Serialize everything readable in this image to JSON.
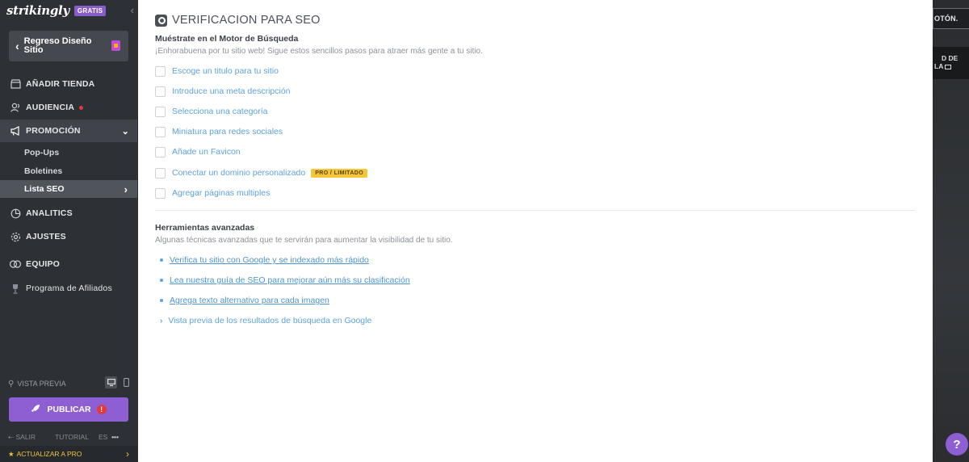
{
  "brand": {
    "logo": "strikingly",
    "plan_badge": "GRATIS",
    "collapse_icon": "chevron-left-icon"
  },
  "back_button": {
    "label": "Regreso Diseño Sitio",
    "icon": "page-icon"
  },
  "nav": {
    "store": {
      "label": "AÑADIR TIENDA",
      "icon": "store-icon"
    },
    "audience": {
      "label": "AUDIENCIA",
      "icon": "audience-icon",
      "has_notification": true
    },
    "promotion": {
      "label": "PROMOCIÓN",
      "icon": "megaphone-icon",
      "expanded": true
    },
    "promotion_sub": [
      {
        "label": "Pop-Ups"
      },
      {
        "label": "Boletines"
      },
      {
        "label": "Lista SEO",
        "active": true
      }
    ],
    "analytics": {
      "label": "ANALITICS",
      "icon": "chart-pie-icon"
    },
    "settings": {
      "label": "AJUSTES",
      "icon": "gear-icon"
    },
    "team": {
      "label": "EQUIPO",
      "icon": "team-icon"
    },
    "affiliates": {
      "label": "Programa de Afiliados",
      "icon": "trophy-icon"
    }
  },
  "preview": {
    "label": "VISTA PREVIA",
    "selected_device": "desktop"
  },
  "publish": {
    "label": "PUBLICAR",
    "alert": "!"
  },
  "footer": {
    "exit": "SALIR",
    "tutorial": "TUTORIAL",
    "lang": "ES",
    "more": "•••"
  },
  "upgrade": {
    "label": "ACTUALIZAR A PRO"
  },
  "seo": {
    "title": "VERIFICACION PARA SEO",
    "heading": "Muéstrate en el Motor de Búsqueda",
    "subheading": "¡Enhorabuena por tu sitio web! Sigue estos sencillos pasos para atraer más gente a tu sitio.",
    "checklist": [
      {
        "label": "Escoge un titulo para tu sitio",
        "checked": false
      },
      {
        "label": "Introduce una meta descripción",
        "checked": false
      },
      {
        "label": "Selecciona una categoría",
        "checked": false
      },
      {
        "label": "Miniatura para redes sociales",
        "checked": false
      },
      {
        "label": "Añade un Favicon",
        "checked": false
      },
      {
        "label": "Conectar un dominio personalizado",
        "checked": false,
        "badge": "PRO / LIMITADO"
      },
      {
        "label": "Agregar páginas multiples",
        "checked": false
      }
    ],
    "advanced_heading": "Herramientas avanzadas",
    "advanced_subheading": "Algunas técnicas avanzadas que te servirán para aumentar la visibilidad de tu sitio.",
    "links": [
      {
        "label": "Verifica tu sitio con Google y se indexado más rápido"
      },
      {
        "label": "Lea nuestra guía de SEO para mejorar aún más su clasificación"
      },
      {
        "label": "Agrega texto alternativo para cada imagen"
      }
    ],
    "preview_toggle": "Vista previa de los resultados de búsqueda en Google"
  },
  "preview_edge": {
    "button_text": "OTÓN.",
    "band_text_1": "D DE",
    "band_text_2": "LA"
  },
  "chat": {
    "label": "?"
  },
  "colors": {
    "sidebar": "#2d3035",
    "accent_purple": "#8d5fd3",
    "link_blue": "#5fa3d9",
    "pro_yellow": "#f5c53a"
  }
}
